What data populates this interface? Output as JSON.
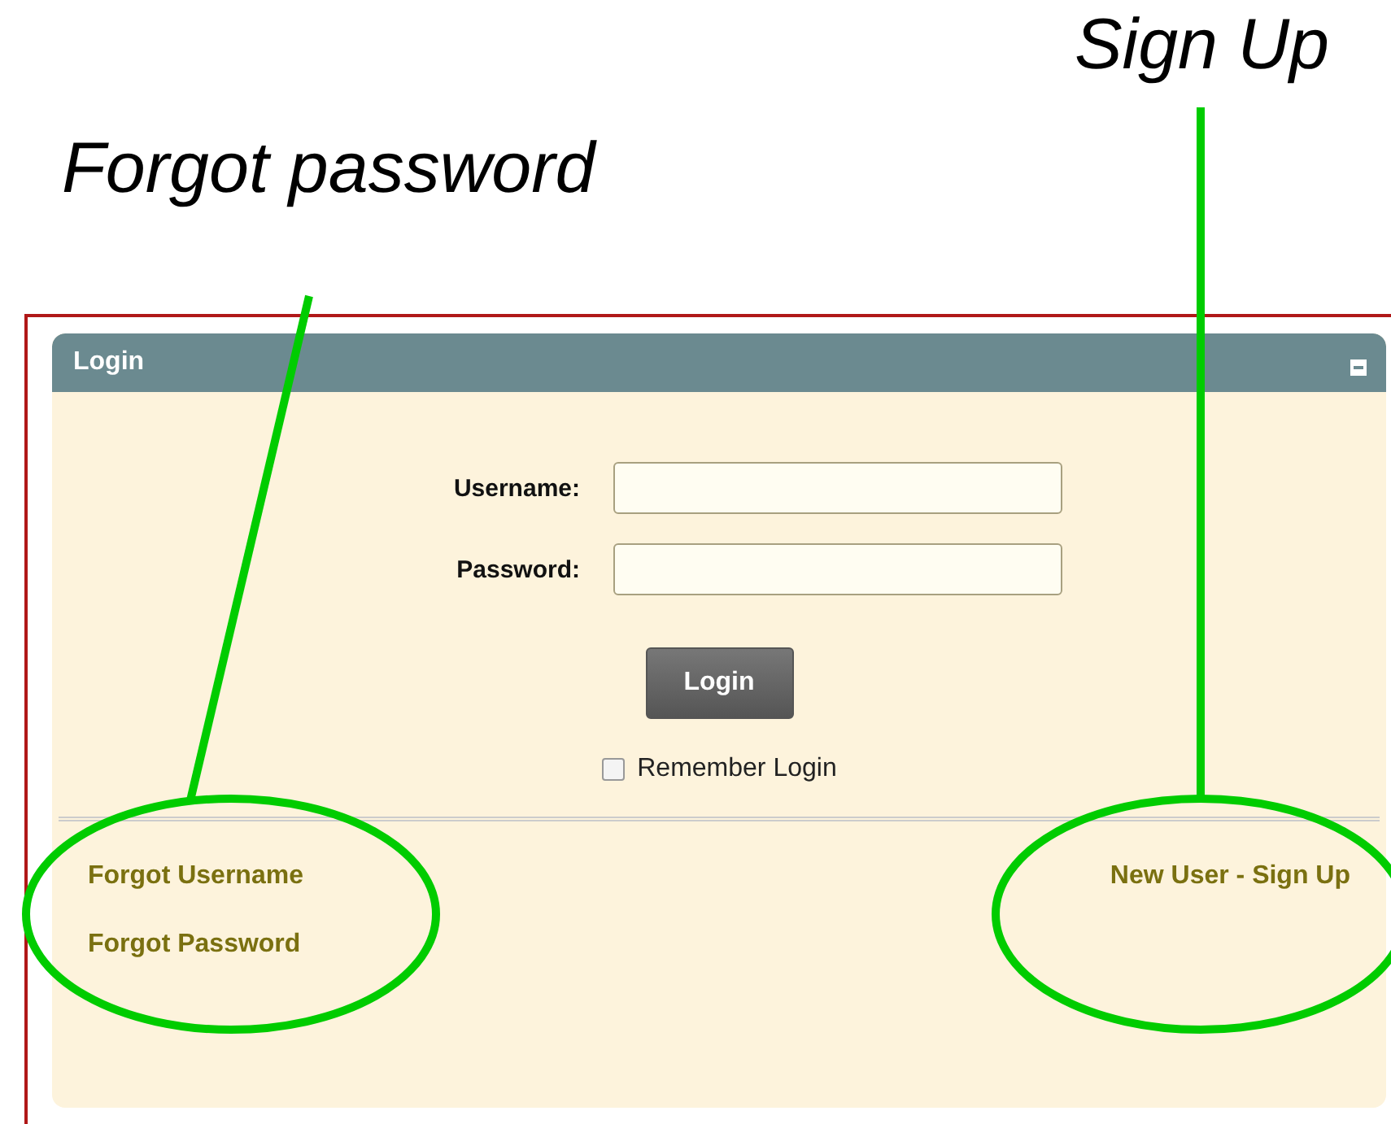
{
  "annotations": [
    {
      "text": "Sign Up"
    },
    {
      "text": "Forgot password"
    }
  ],
  "panel": {
    "title": "Login",
    "collapsed": false
  },
  "fields": [
    {
      "label": "Username:"
    },
    {
      "label": "Password:"
    }
  ],
  "login_button": "Login",
  "remember": {
    "label": "Remember Login",
    "checked": false
  },
  "links_left": [
    {
      "text": "Forgot Username"
    },
    {
      "text": "Forgot Password"
    }
  ],
  "links_right": [
    {
      "text": "New User - Sign Up"
    }
  ]
}
